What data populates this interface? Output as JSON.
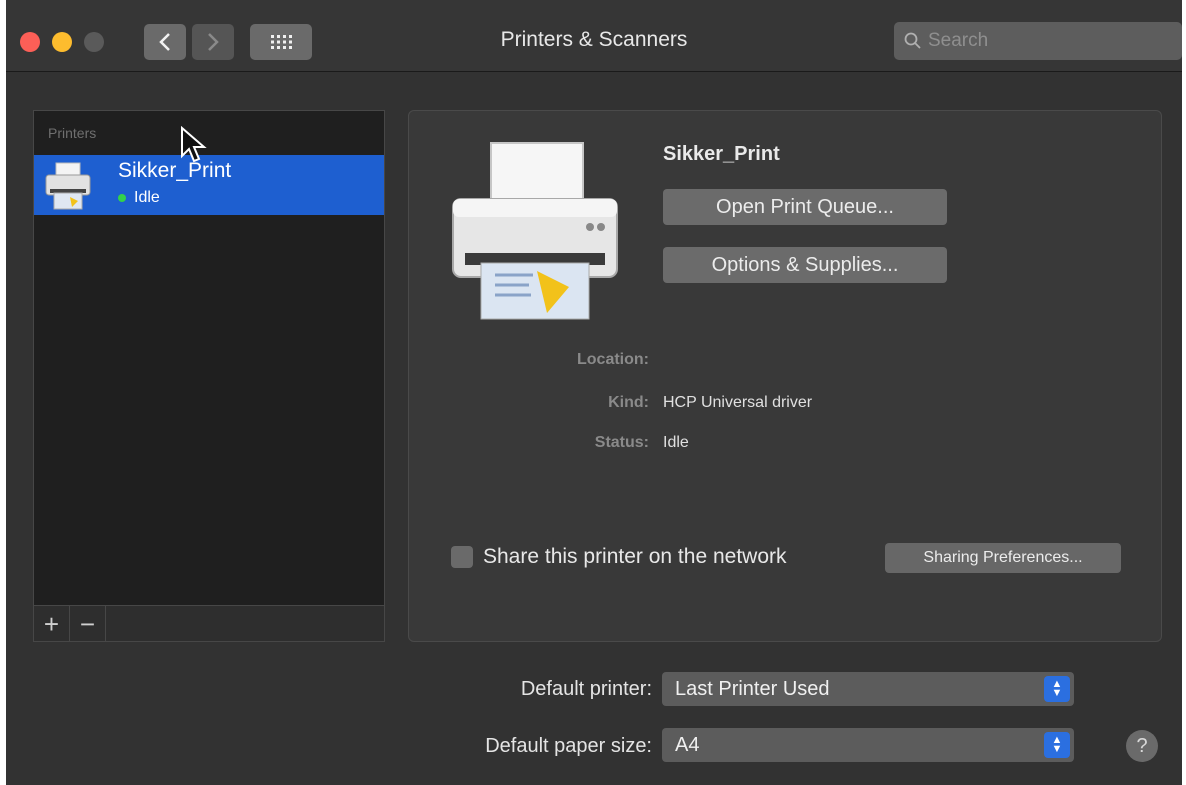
{
  "window": {
    "title": "Printers & Scanners",
    "search_placeholder": "Search"
  },
  "sidebar": {
    "header": "Printers",
    "printers": [
      {
        "name": "Sikker_Print",
        "status": "Idle",
        "status_color": "#33d14a"
      }
    ],
    "add_label": "+",
    "remove_label": "−"
  },
  "detail": {
    "printer_name": "Sikker_Print",
    "open_queue_label": "Open Print Queue...",
    "options_label": "Options & Supplies...",
    "location_label": "Location:",
    "location_value": "",
    "kind_label": "Kind:",
    "kind_value": "HCP Universal driver",
    "status_label": "Status:",
    "status_value": "Idle",
    "share_label": "Share this printer on the network",
    "share_checked": false,
    "sharing_prefs_label": "Sharing Preferences..."
  },
  "defaults": {
    "printer_label": "Default printer:",
    "printer_value": "Last Printer Used",
    "paper_label": "Default paper size:",
    "paper_value": "A4"
  },
  "help_label": "?",
  "colors": {
    "accent": "#1e5fd0",
    "close": "#fc5f57",
    "minimize": "#fdbc2e"
  }
}
